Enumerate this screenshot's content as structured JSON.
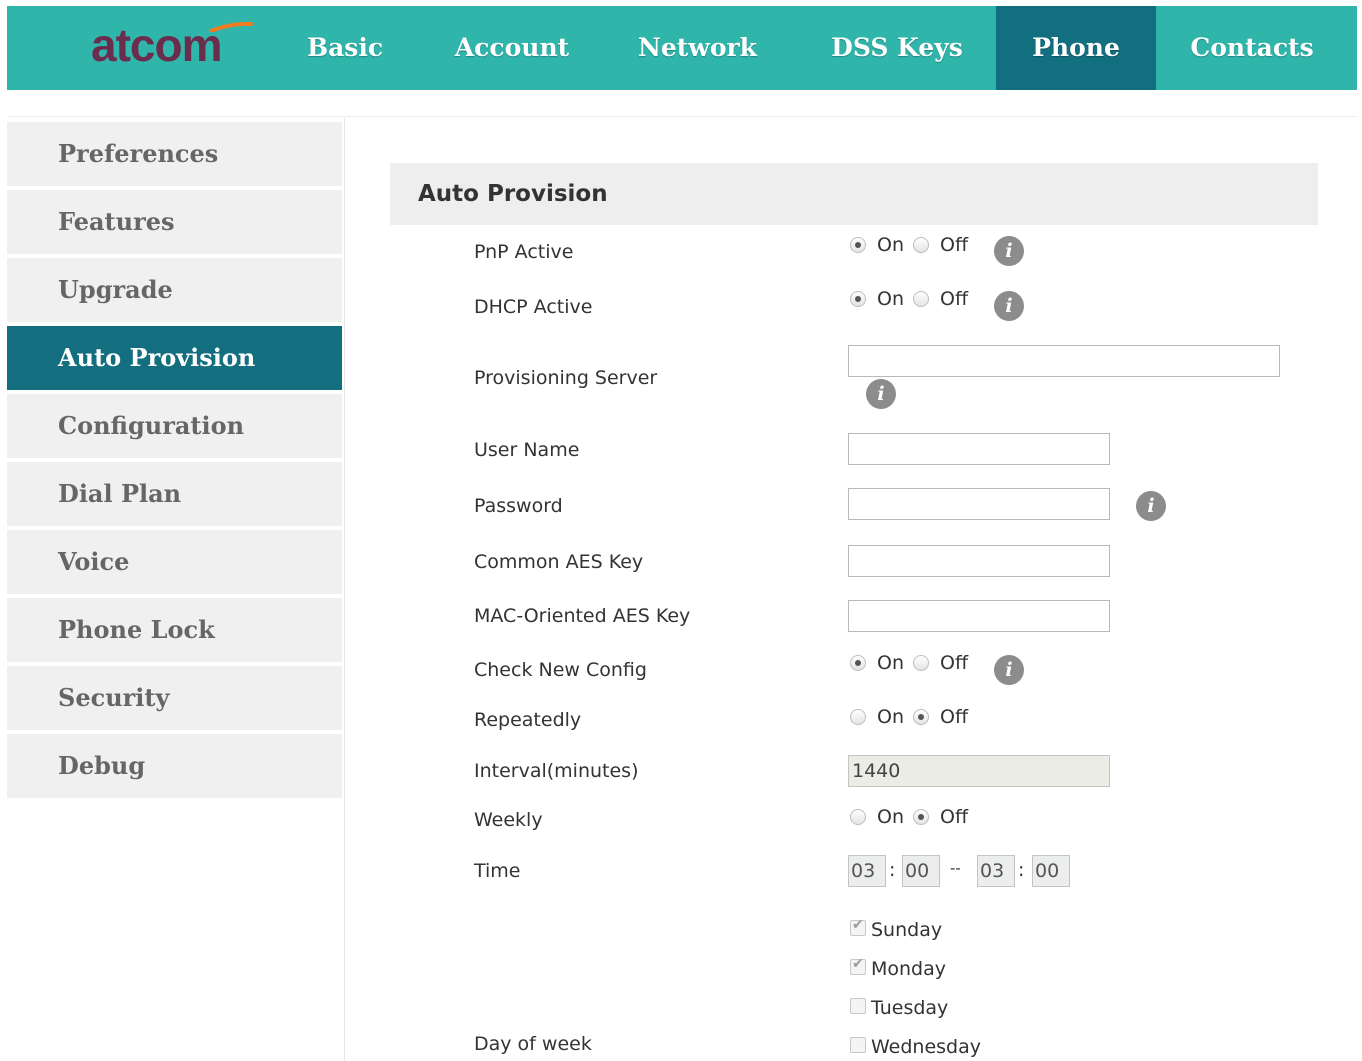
{
  "brand": {
    "logo_text": "atcom"
  },
  "nav": {
    "items": [
      {
        "label": "Basic"
      },
      {
        "label": "Account"
      },
      {
        "label": "Network"
      },
      {
        "label": "DSS Keys"
      },
      {
        "label": "Phone"
      },
      {
        "label": "Contacts"
      }
    ],
    "active": "Phone"
  },
  "sidebar": {
    "items": [
      {
        "label": "Preferences"
      },
      {
        "label": "Features"
      },
      {
        "label": "Upgrade"
      },
      {
        "label": "Auto Provision"
      },
      {
        "label": "Configuration"
      },
      {
        "label": "Dial Plan"
      },
      {
        "label": "Voice"
      },
      {
        "label": "Phone Lock"
      },
      {
        "label": "Security"
      },
      {
        "label": "Debug"
      }
    ],
    "active": "Auto Provision"
  },
  "section": {
    "title": "Auto Provision"
  },
  "radio_labels": {
    "on": "On",
    "off": "Off"
  },
  "form": {
    "pnp_active": {
      "label": "PnP Active",
      "value": "On"
    },
    "dhcp_active": {
      "label": "DHCP Active",
      "value": "On"
    },
    "provisioning_server": {
      "label": "Provisioning Server",
      "value": ""
    },
    "user_name": {
      "label": "User Name",
      "value": ""
    },
    "password": {
      "label": "Password",
      "value": ""
    },
    "common_aes_key": {
      "label": "Common AES Key",
      "value": ""
    },
    "mac_aes_key": {
      "label": "MAC-Oriented AES Key",
      "value": ""
    },
    "check_new_config": {
      "label": "Check New Config",
      "value": "On"
    },
    "repeatedly": {
      "label": "Repeatedly",
      "value": "Off"
    },
    "interval": {
      "label": "Interval(minutes)",
      "value": "1440"
    },
    "weekly": {
      "label": "Weekly",
      "value": "Off"
    },
    "time": {
      "label": "Time",
      "start_hour": "03",
      "start_min": "00",
      "end_hour": "03",
      "end_min": "00",
      "colon": ":",
      "dash": "--"
    },
    "day_of_week": {
      "label": "Day of week",
      "days": [
        {
          "label": "Sunday",
          "checked": true
        },
        {
          "label": "Monday",
          "checked": true
        },
        {
          "label": "Tuesday",
          "checked": false
        },
        {
          "label": "Wednesday",
          "checked": false
        }
      ]
    }
  },
  "info_icon_glyph": "i",
  "colors": {
    "nav_bg": "#2fb5aa",
    "nav_active": "#116f7f",
    "sidebar_active": "#136f80",
    "logo": "#6b2d4e",
    "logo_accent": "#f07c22"
  }
}
